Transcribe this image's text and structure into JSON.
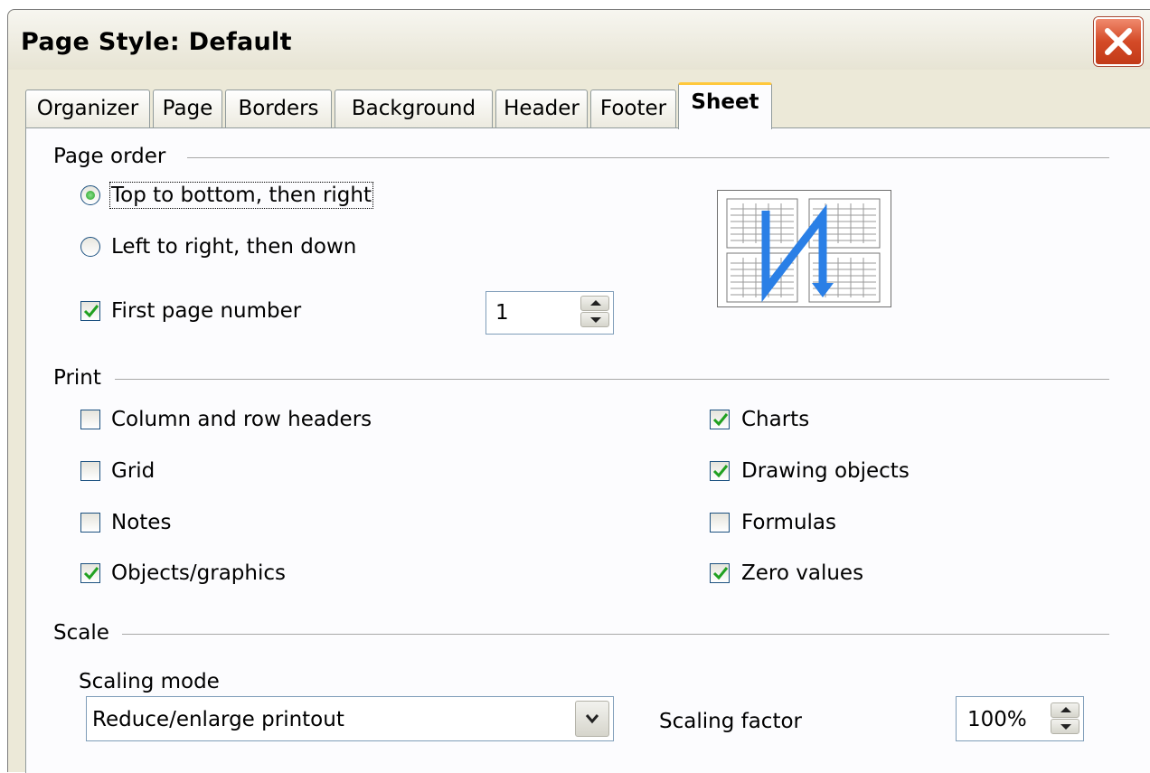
{
  "dialog": {
    "title": "Page Style: Default",
    "tabs": [
      "Organizer",
      "Page",
      "Borders",
      "Background",
      "Header",
      "Footer",
      "Sheet"
    ],
    "active_tab": "Sheet"
  },
  "page_order": {
    "heading": "Page order",
    "options": [
      {
        "label": "Top to bottom, then right",
        "selected": true
      },
      {
        "label": "Left to right, then down",
        "selected": false
      }
    ],
    "first_page_number": {
      "label": "First page number",
      "checked": true,
      "value": "1"
    }
  },
  "print": {
    "heading": "Print",
    "left": [
      {
        "label": "Column and row headers",
        "checked": false
      },
      {
        "label": "Grid",
        "checked": false
      },
      {
        "label": "Notes",
        "checked": false
      },
      {
        "label": "Objects/graphics",
        "checked": true
      }
    ],
    "right": [
      {
        "label": "Charts",
        "checked": true
      },
      {
        "label": "Drawing objects",
        "checked": true
      },
      {
        "label": "Formulas",
        "checked": false
      },
      {
        "label": "Zero values",
        "checked": true
      }
    ]
  },
  "scale": {
    "heading": "Scale",
    "mode_label": "Scaling mode",
    "mode_value": "Reduce/enlarge printout",
    "factor_label": "Scaling factor",
    "factor_value": "100%"
  },
  "colors": {
    "accent_tab": "#ffc83c",
    "checkmark": "#21a121",
    "preview_arrow": "#2a7fe6",
    "close_button": "#d44a27"
  }
}
